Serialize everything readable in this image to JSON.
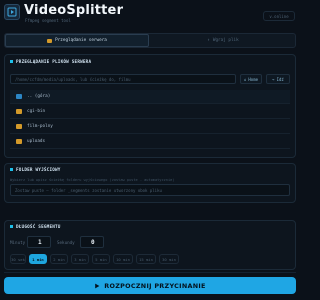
{
  "header": {
    "title": "VideoSplitter",
    "subtitle": "Ffmpeg segment tool",
    "version": "v.online"
  },
  "tabs": [
    {
      "label": "Przeglądanie serwera",
      "active": true
    },
    {
      "label": "Wgraj plik",
      "active": false
    }
  ],
  "browser": {
    "title": "PRZEGLĄDANIE PLIKÓW SERWERA",
    "path_placeholder": "/home/ccfdm/media/uploads, lub ścieżkę do, filmu",
    "home_button": "Home",
    "go_button": "Idź",
    "files": [
      {
        "name": ".. (góra)",
        "type": "up"
      },
      {
        "name": "cgi-bin",
        "type": "dir"
      },
      {
        "name": "film-polny",
        "type": "dir"
      },
      {
        "name": "uploads",
        "type": "dir"
      }
    ]
  },
  "output": {
    "title": "FOLDER WYJŚCIOWY",
    "note": "Wybierz lub wpisz ścieżkę folderu wyjściowego (zostaw puste - automatycznie)",
    "placeholder": "Zostaw puste — folder _segments zostanie utworzony obok pliku"
  },
  "segments": {
    "title": "DŁUGOŚĆ SEGMENTU",
    "minutes_label": "Minuty",
    "minutes_value": "1",
    "seconds_label": "Sekundy",
    "seconds_value": "0",
    "presets": [
      {
        "label": "30 sek",
        "active": false
      },
      {
        "label": "1 min",
        "active": true
      },
      {
        "label": "2 min",
        "active": false
      },
      {
        "label": "3 min",
        "active": false
      },
      {
        "label": "5 min",
        "active": false
      },
      {
        "label": "10 min",
        "active": false
      },
      {
        "label": "15 min",
        "active": false
      },
      {
        "label": "30 min",
        "active": false
      }
    ]
  },
  "cta": {
    "label": "ROZPOCZNIJ PRZYCINANIE"
  },
  "colors": {
    "accent": "#1fa6e4",
    "folder": "#d49a2a",
    "background": "#0b1119"
  }
}
